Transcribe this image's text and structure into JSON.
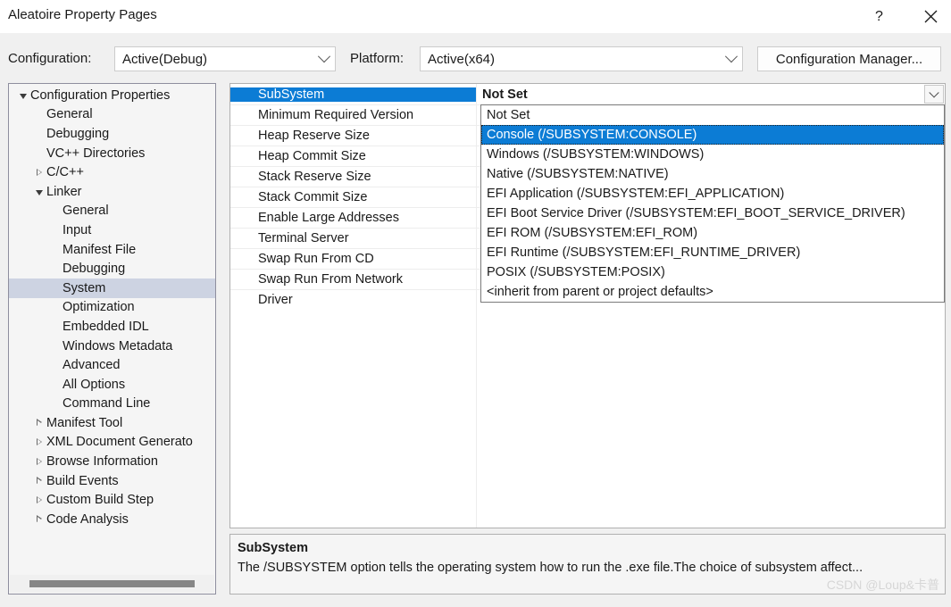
{
  "window": {
    "title": "Aleatoire Property Pages",
    "help_glyph": "?",
    "close_glyph": "✕"
  },
  "configbar": {
    "configuration_label": "Configuration:",
    "configuration_value": "Active(Debug)",
    "platform_label": "Platform:",
    "platform_value": "Active(x64)",
    "config_manager_label": "Configuration Manager..."
  },
  "tree": {
    "items": [
      {
        "label": "Configuration Properties",
        "indent": 0,
        "arrow": "open",
        "selected": false
      },
      {
        "label": "General",
        "indent": 1,
        "arrow": "none",
        "selected": false
      },
      {
        "label": "Debugging",
        "indent": 1,
        "arrow": "none",
        "selected": false
      },
      {
        "label": "VC++ Directories",
        "indent": 1,
        "arrow": "none",
        "selected": false
      },
      {
        "label": "C/C++",
        "indent": 1,
        "arrow": "closed",
        "selected": false
      },
      {
        "label": "Linker",
        "indent": 1,
        "arrow": "open",
        "selected": false
      },
      {
        "label": "General",
        "indent": 2,
        "arrow": "none",
        "selected": false
      },
      {
        "label": "Input",
        "indent": 2,
        "arrow": "none",
        "selected": false
      },
      {
        "label": "Manifest File",
        "indent": 2,
        "arrow": "none",
        "selected": false
      },
      {
        "label": "Debugging",
        "indent": 2,
        "arrow": "none",
        "selected": false
      },
      {
        "label": "System",
        "indent": 2,
        "arrow": "none",
        "selected": true
      },
      {
        "label": "Optimization",
        "indent": 2,
        "arrow": "none",
        "selected": false
      },
      {
        "label": "Embedded IDL",
        "indent": 2,
        "arrow": "none",
        "selected": false
      },
      {
        "label": "Windows Metadata",
        "indent": 2,
        "arrow": "none",
        "selected": false
      },
      {
        "label": "Advanced",
        "indent": 2,
        "arrow": "none",
        "selected": false
      },
      {
        "label": "All Options",
        "indent": 2,
        "arrow": "none",
        "selected": false
      },
      {
        "label": "Command Line",
        "indent": 2,
        "arrow": "none",
        "selected": false
      },
      {
        "label": "Manifest Tool",
        "indent": 1,
        "arrow": "closed",
        "selected": false
      },
      {
        "label": "XML Document Generato",
        "indent": 1,
        "arrow": "closed",
        "selected": false
      },
      {
        "label": "Browse Information",
        "indent": 1,
        "arrow": "closed",
        "selected": false
      },
      {
        "label": "Build Events",
        "indent": 1,
        "arrow": "closed",
        "selected": false
      },
      {
        "label": "Custom Build Step",
        "indent": 1,
        "arrow": "closed",
        "selected": false
      },
      {
        "label": "Code Analysis",
        "indent": 1,
        "arrow": "closed",
        "selected": false
      }
    ]
  },
  "grid": {
    "rows": [
      {
        "name": "SubSystem",
        "value": "Not Set",
        "selected": true
      },
      {
        "name": "Minimum Required Version",
        "value": "",
        "selected": false
      },
      {
        "name": "Heap Reserve Size",
        "value": "",
        "selected": false
      },
      {
        "name": "Heap Commit Size",
        "value": "",
        "selected": false
      },
      {
        "name": "Stack Reserve Size",
        "value": "",
        "selected": false
      },
      {
        "name": "Stack Commit Size",
        "value": "",
        "selected": false
      },
      {
        "name": "Enable Large Addresses",
        "value": "",
        "selected": false
      },
      {
        "name": "Terminal Server",
        "value": "",
        "selected": false
      },
      {
        "name": "Swap Run From CD",
        "value": "",
        "selected": false
      },
      {
        "name": "Swap Run From Network",
        "value": "",
        "selected": false
      },
      {
        "name": "Driver",
        "value": "",
        "selected": false
      }
    ]
  },
  "dropdown": {
    "options": [
      {
        "label": "Not Set",
        "selected": false
      },
      {
        "label": "Console (/SUBSYSTEM:CONSOLE)",
        "selected": true
      },
      {
        "label": "Windows (/SUBSYSTEM:WINDOWS)",
        "selected": false
      },
      {
        "label": "Native (/SUBSYSTEM:NATIVE)",
        "selected": false
      },
      {
        "label": "EFI Application (/SUBSYSTEM:EFI_APPLICATION)",
        "selected": false
      },
      {
        "label": "EFI Boot Service Driver (/SUBSYSTEM:EFI_BOOT_SERVICE_DRIVER)",
        "selected": false
      },
      {
        "label": "EFI ROM (/SUBSYSTEM:EFI_ROM)",
        "selected": false
      },
      {
        "label": "EFI Runtime (/SUBSYSTEM:EFI_RUNTIME_DRIVER)",
        "selected": false
      },
      {
        "label": "POSIX (/SUBSYSTEM:POSIX)",
        "selected": false
      },
      {
        "label": "<inherit from parent or project defaults>",
        "selected": false
      }
    ]
  },
  "description": {
    "title": "SubSystem",
    "body": "The /SUBSYSTEM option tells the operating system how to run the .exe file.The choice of subsystem affect...",
    "watermark": "CSDN @Loup&卡普"
  },
  "colors": {
    "accent": "#0c7cd5",
    "tree_selection": "#cdd3e2",
    "dialog_background": "#f0f0f0",
    "panel_background": "#f5f5f5"
  }
}
